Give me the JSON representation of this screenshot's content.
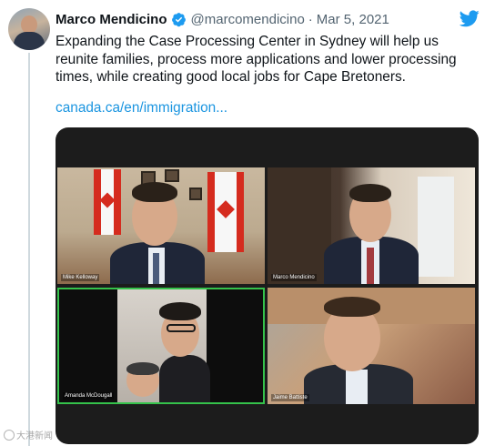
{
  "tweet": {
    "author_name": "Marco Mendicino",
    "handle": "@marcomendicino",
    "separator": "·",
    "date": "Mar 5, 2021",
    "text": "Expanding the Case Processing Center in Sydney will help us reunite families, process more applications and lower processing times, while creating good local jobs for Cape Bretoners.",
    "link": "canada.ca/en/immigration...",
    "verified_icon": "verified-badge-icon",
    "brand_icon": "twitter-bird-icon",
    "accent_color": "#1d9bf0"
  },
  "media": {
    "participants": [
      {
        "label": "Mike Kelloway"
      },
      {
        "label": "Marco Mendicino"
      },
      {
        "label": "Amanda McDougall"
      },
      {
        "label": "Jaime Battiste"
      }
    ],
    "active_speaker_border_color": "#35c24b"
  },
  "watermark": {
    "text": "大港新闻"
  }
}
